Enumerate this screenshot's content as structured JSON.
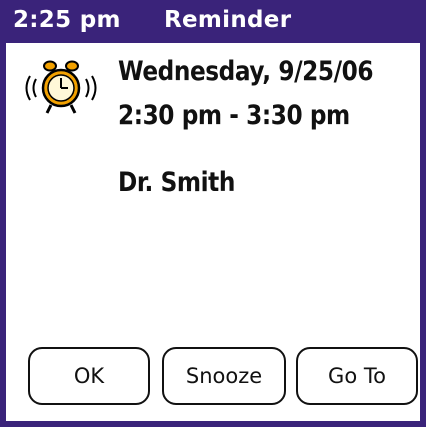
{
  "title_bar": {
    "time": "2:25 pm",
    "title": "Reminder"
  },
  "alarm": {
    "icon": "alarm-clock-ringing-icon"
  },
  "event": {
    "date": "Wednesday, 9/25/06",
    "time_range": "2:30 pm - 3:30 pm",
    "title": "Dr. Smith"
  },
  "buttons": {
    "ok": "OK",
    "snooze": "Snooze",
    "goto": "Go To"
  },
  "colors": {
    "title_bar": "#3a237a",
    "title_text": "#ffffff",
    "bell": "#f2a100"
  }
}
